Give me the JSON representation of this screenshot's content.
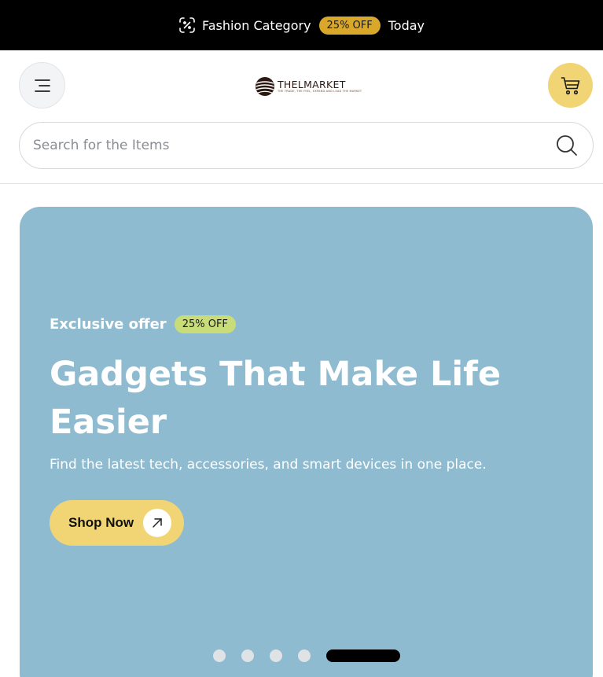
{
  "promo": {
    "icon": "discount-tag-icon",
    "label": "Fashion Category",
    "badge": "25% OFF",
    "suffix": "Today",
    "badge_color": "#d9a82b"
  },
  "header": {
    "menu_icon": "hamburger-menu-icon",
    "logo": {
      "name": "THELMARKET",
      "tagline": "THE TRADE, THE FEEL, EXPAND AND LEAD THE MARKET"
    },
    "cart_icon": "shopping-cart-icon",
    "cart_color": "#f1d575"
  },
  "search": {
    "placeholder": "Search for the Items",
    "value": "",
    "icon": "search-icon"
  },
  "hero": {
    "background": "#8fbbd0",
    "eyebrow": "Exclusive offer",
    "badge": "25% OFF",
    "title": "Gadgets That Make Life Easier",
    "subtitle": "Find the latest tech, accessories, and smart devices in one place.",
    "cta_label": "Shop Now",
    "cta_icon": "arrow-up-right-icon",
    "slides": {
      "count": 5,
      "active_index": 4
    }
  }
}
